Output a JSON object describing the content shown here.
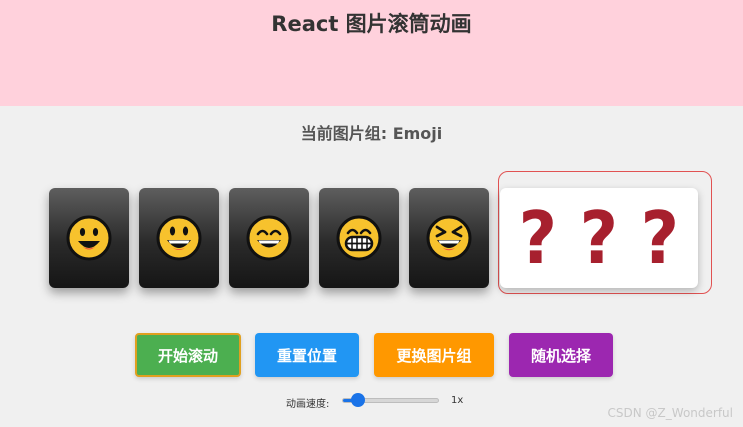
{
  "header": {
    "title": "React 图片滚筒动画",
    "background": "#ffd1dc"
  },
  "subtitle": "当前图片组: Emoji",
  "reel": {
    "cards": [
      {
        "icon": "smiling-face-icon"
      },
      {
        "icon": "grinning-face-icon"
      },
      {
        "icon": "beaming-face-icon"
      },
      {
        "icon": "grinning-teeth-face-icon"
      },
      {
        "icon": "squinting-laughing-face-icon"
      }
    ],
    "mystery": {
      "symbols": [
        "?",
        "?",
        "?"
      ],
      "color": "#a7202e"
    },
    "highlight_color": "#e15252"
  },
  "buttons": {
    "start": {
      "label": "开始滚动",
      "color": "#4caf50"
    },
    "reset": {
      "label": "重置位置",
      "color": "#2196f3"
    },
    "switch": {
      "label": "更换图片组",
      "color": "#ff9800"
    },
    "random": {
      "label": "随机选择",
      "color": "#9c27b0"
    }
  },
  "speed": {
    "label": "动画速度:",
    "value_text": "1x",
    "level": 0.16
  },
  "watermark": "CSDN @Z_Wonderful"
}
